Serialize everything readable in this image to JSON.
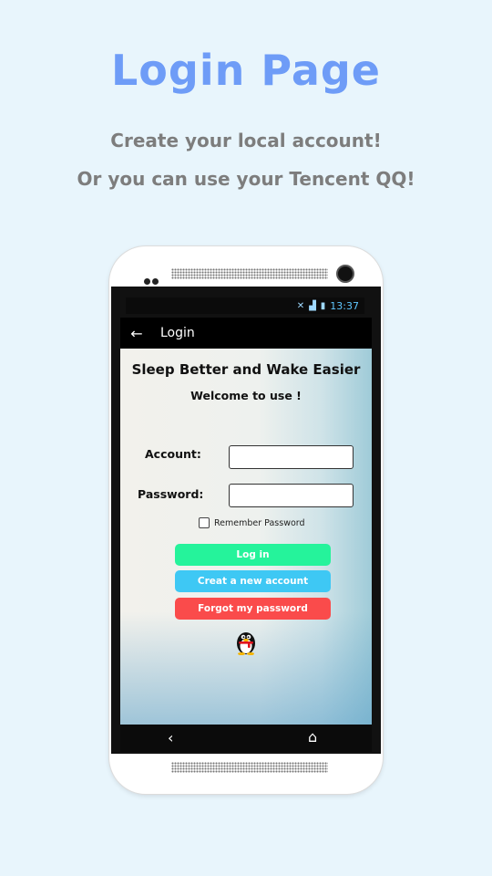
{
  "promo": {
    "headline": "Login Page",
    "line1": "Create your local account!",
    "line2": "Or you can use your Tencent QQ!"
  },
  "status_bar": {
    "time": "13:37",
    "icons": [
      "mute-icon",
      "signal-icon",
      "battery-icon"
    ]
  },
  "action_bar": {
    "back_icon": "back-arrow-icon",
    "title": "Login"
  },
  "login": {
    "app_title": "Sleep Better and Wake Easier",
    "welcome": "Welcome to use !",
    "account_label": "Account:",
    "account_value": "",
    "password_label": "Password:",
    "password_value": "",
    "remember_label": "Remember Password",
    "remember_checked": false,
    "buttons": {
      "login": "Log in",
      "create": "Creat a new account",
      "forgot": "Forgot my password"
    },
    "qq_icon": "qq-penguin-icon"
  },
  "nav_bar": {
    "icons": [
      "nav-back-icon",
      "nav-home-icon"
    ]
  },
  "colors": {
    "background": "#e8f5fc",
    "headline": "#6e9cf7",
    "login_button": "#25f39b",
    "create_button": "#3ec8f4",
    "forgot_button": "#fa4b4b",
    "status_text": "#5fc7ff"
  }
}
